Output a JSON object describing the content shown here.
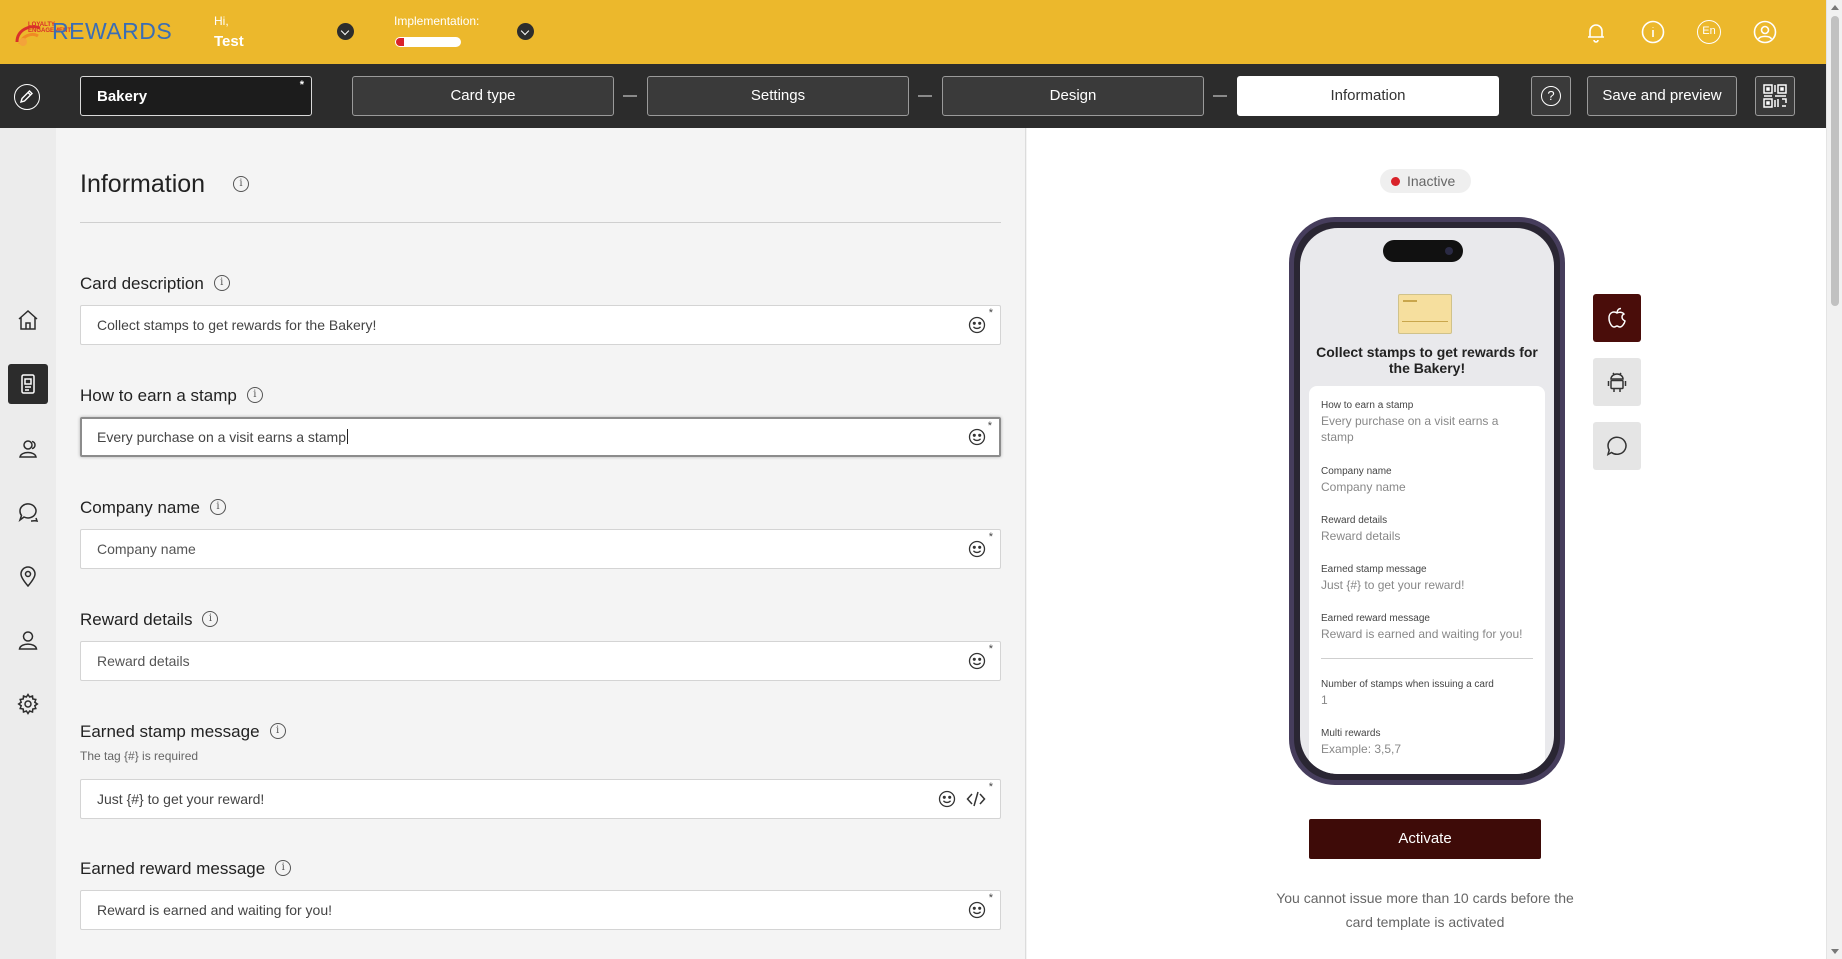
{
  "header": {
    "logo_text": "REWARDS",
    "logo_badge_text": "LOYALTY ENGAGEMENT",
    "greeting": "Hi,",
    "user_name": "Test",
    "implementation_label": "Implementation:",
    "implementation_progress": 0.12,
    "language": "En",
    "icons": [
      "bell-icon",
      "info-icon",
      "language-icon",
      "user-icon"
    ],
    "accent_color": "#ecb82c"
  },
  "toolbar": {
    "card_name": "Bakery",
    "required_marker": "*",
    "steps": [
      "Card type",
      "Settings",
      "Design",
      "Information"
    ],
    "active_step": "Information",
    "help_symbol": "?",
    "save_label": "Save and preview"
  },
  "sidebar": {
    "items": [
      "home-icon",
      "card-icon",
      "users-icon",
      "chat-icon",
      "location-icon",
      "user-icon",
      "gear-icon"
    ],
    "active": "card-icon"
  },
  "form": {
    "title": "Information",
    "info_symbol": "i",
    "fields": [
      {
        "label": "Card description",
        "value": "Collect stamps to get rewards for the Bakery!",
        "placeholder": "",
        "required": "*"
      },
      {
        "label": "How to earn a stamp",
        "value": "Every purchase on a visit earns a stamp",
        "placeholder": "",
        "required": "*"
      },
      {
        "label": "Company name",
        "value": "",
        "placeholder": "Company name",
        "required": "*"
      },
      {
        "label": "Reward details",
        "value": "",
        "placeholder": "Reward details",
        "required": "*"
      },
      {
        "label": "Earned stamp message",
        "sublabel": "The tag {#} is required",
        "value": "Just {#} to get your reward!",
        "placeholder": "",
        "required": "*"
      },
      {
        "label": "Earned reward message",
        "value": "Reward is earned and waiting for you!",
        "placeholder": "",
        "required": "*"
      }
    ]
  },
  "preview": {
    "status": "Inactive",
    "status_color": "#d9232a",
    "phone_title": "Collect stamps to get rewards for the Bakery!",
    "items": [
      {
        "label": "How to earn a stamp",
        "value": "Every purchase on a visit earns a stamp"
      },
      {
        "label": "Company name",
        "value": "Company name"
      },
      {
        "label": "Reward details",
        "value": "Reward details"
      },
      {
        "label": "Earned stamp message",
        "value": "Just {#} to get your reward!"
      },
      {
        "label": "Earned reward message",
        "value": "Reward is earned and waiting for you!"
      }
    ],
    "items_after_divider": [
      {
        "label": "Number of stamps when issuing a card",
        "value": "1"
      },
      {
        "label": "Multi rewards",
        "value": "Example: 3,5,7"
      }
    ],
    "platforms": [
      "apple-icon",
      "android-icon",
      "chat-icon"
    ],
    "active_platform": "apple-icon",
    "activate_label": "Activate",
    "activate_color": "#3e0b08",
    "limit_text": "You cannot issue more than 10 cards before the card template is activated"
  }
}
